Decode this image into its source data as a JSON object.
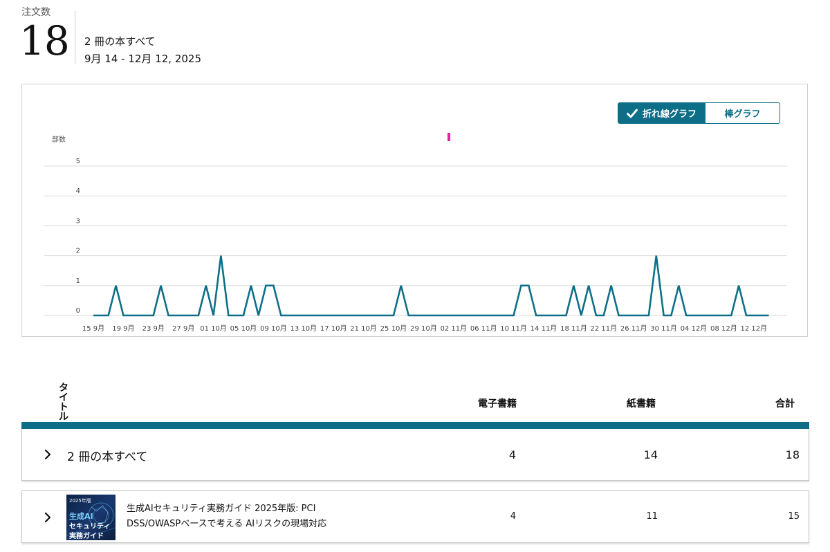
{
  "summary": {
    "label": "注文数",
    "count": "18",
    "title": "2 冊の本すべて",
    "date_range": "9月 14 - 12月 12, 2025"
  },
  "chart_toggle": {
    "line_label": "折れ線グラフ",
    "bar_label": "棒グラフ",
    "selected": "line"
  },
  "colors": {
    "accent": "#0d6f87",
    "marker": "#e0239b",
    "grid": "#d8d8d8"
  },
  "chart_data": {
    "type": "line",
    "ylabel": "部数",
    "ylim": [
      0,
      5
    ],
    "yticks": [
      "0",
      "1",
      "2",
      "3",
      "4",
      "5"
    ],
    "grid": true,
    "xticks": [
      "15 9月",
      "19 9月",
      "23 9月",
      "27 9月",
      "01 10月",
      "05 10月",
      "09 10月",
      "13 10月",
      "17 10月",
      "21 10月",
      "25 10月",
      "29 10月",
      "02 11月",
      "06 11月",
      "10 11月",
      "14 11月",
      "18 11月",
      "22 11月",
      "26 11月",
      "30 11月",
      "04 12月",
      "08 12月",
      "12 12月"
    ],
    "start_label": "15 9月",
    "series": [
      {
        "values": [
          0,
          0,
          0,
          1,
          0,
          0,
          0,
          0,
          0,
          1,
          0,
          0,
          0,
          0,
          0,
          1,
          0,
          2,
          0,
          0,
          0,
          1,
          0,
          1,
          1,
          0,
          0,
          0,
          0,
          0,
          0,
          0,
          0,
          0,
          0,
          0,
          0,
          0,
          0,
          0,
          0,
          1,
          0,
          0,
          0,
          0,
          0,
          0,
          0,
          0,
          0,
          0,
          0,
          0,
          0,
          0,
          0,
          1,
          1,
          0,
          0,
          0,
          0,
          0,
          1,
          0,
          1,
          0,
          0,
          1,
          0,
          0,
          0,
          0,
          0,
          2,
          0,
          0,
          1,
          0,
          0,
          0,
          0,
          0,
          0,
          0,
          1,
          0,
          0,
          0,
          0
        ]
      }
    ]
  },
  "table": {
    "headers": {
      "title": "タイトル",
      "ebook": "電子書籍",
      "print": "紙書籍",
      "total": "合計"
    },
    "all_row": {
      "label": "2 冊の本すべて",
      "ebook": "4",
      "print": "14",
      "total": "18"
    },
    "book_row": {
      "title": "生成AIセキュリティ実務ガイド 2025年版: PCI DSS/OWASPベースで考える AIリスクの現場対応",
      "ebook": "4",
      "print": "11",
      "total": "15",
      "cover": {
        "year": "2025年版",
        "line1": "生成AI",
        "line2": "セキュリティ",
        "line3": "実務ガイド"
      }
    }
  }
}
